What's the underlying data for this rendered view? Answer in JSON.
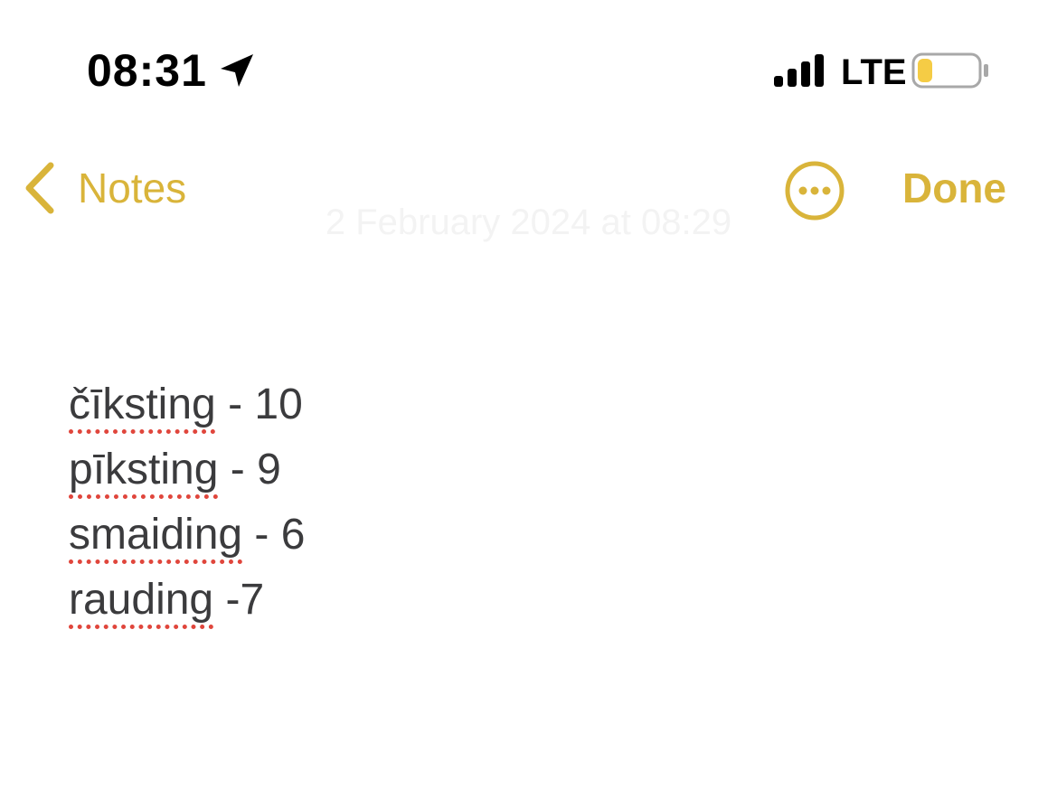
{
  "status_bar": {
    "time": "08:31",
    "network": "LTE",
    "battery_level": 0.25,
    "signal_bars": 4,
    "location_icon": "location-arrow-icon"
  },
  "nav": {
    "back_label": "Notes",
    "done_label": "Done",
    "more_icon": "ellipsis-circle-icon",
    "back_icon": "chevron-left-icon"
  },
  "note": {
    "date": "2 February 2024 at 08:29",
    "lines": [
      {
        "word": "čīksting",
        "rest": " - 10"
      },
      {
        "word": "pīksting",
        "rest": " - 9"
      },
      {
        "word": "smaiding",
        "rest": " - 6"
      },
      {
        "word": "rauding",
        "rest": " -7"
      }
    ]
  },
  "colors": {
    "accent": "#d9b43a",
    "text": "#3b3b3d",
    "spellcheck": "#e0463c",
    "battery_fill": "#f5cc45"
  }
}
